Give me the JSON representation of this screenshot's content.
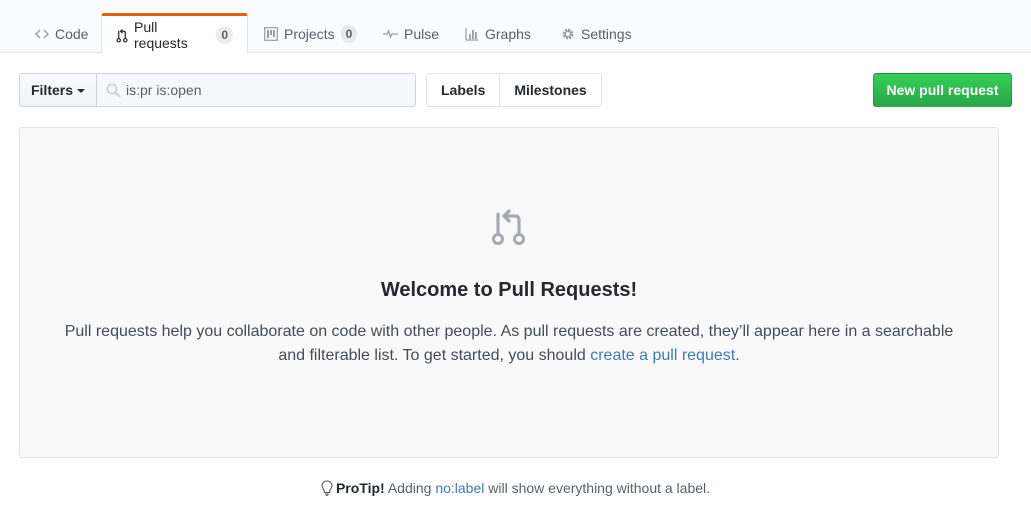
{
  "tabs": [
    {
      "label": "Code",
      "icon": "code-icon"
    },
    {
      "label": "Pull requests",
      "icon": "git-pull-request-icon",
      "count": "0",
      "selected": true
    },
    {
      "label": "Projects",
      "icon": "project-icon",
      "count": "0"
    },
    {
      "label": "Pulse",
      "icon": "pulse-icon"
    },
    {
      "label": "Graphs",
      "icon": "graph-icon"
    },
    {
      "label": "Settings",
      "icon": "gear-icon"
    }
  ],
  "subnav": {
    "filters_label": "Filters",
    "search_value": "is:pr is:open",
    "labels_label": "Labels",
    "milestones_label": "Milestones",
    "new_pr_label": "New pull request"
  },
  "blankslate": {
    "icon": "git-pull-request-icon",
    "title": "Welcome to Pull Requests!",
    "text_before": "Pull requests help you collaborate on code with other people. As pull requests are created, they’ll appear here in a searchable and filterable list. To get started, you should ",
    "link_text": "create a pull request",
    "text_after": "."
  },
  "protip": {
    "icon": "light-bulb-icon",
    "label": "ProTip!",
    "before": " Adding ",
    "link": "no:label",
    "after": " will show everything without a label."
  },
  "colors": {
    "accent_tab": "#e36209",
    "primary_button": "#28a745",
    "link": "#4078c0"
  }
}
